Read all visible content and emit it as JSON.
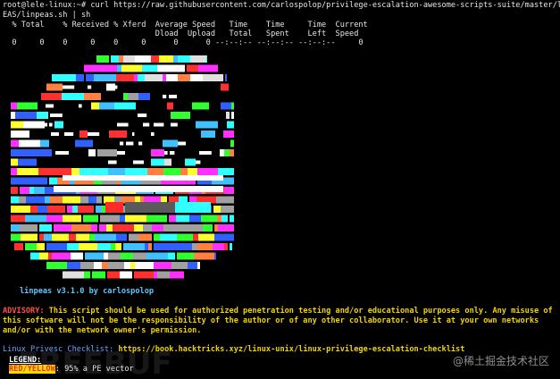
{
  "terminal": {
    "prompt": "root@lele-linux:~#",
    "command_line1": " curl https://raw.githubusercontent.com/carlospolop/privilege-escalation-awesome-scripts-suite/master/linP",
    "command_line2": "EAS/linpeas.sh | sh",
    "curl_header1": "  % Total    % Received % Xferd  Average Speed   Time    Time     Time  Current",
    "curl_header2": "                                 Dload  Upload   Total   Spent    Left  Speed",
    "curl_progress": "  0     0    0     0    0     0      0      0 --:--:-- --:--:-- --:--:--     0"
  },
  "logo": {
    "caption": "linpeas v3.1.0 by carlospolop"
  },
  "advisory": {
    "label": "ADVISORY:",
    "text": " This script should be used for authorized penetration testing and/or educational purposes only. Any misuse of this software will not be the responsibility of the author or of any other collaborator. Use it at your own networks and/or with the network owner's permission."
  },
  "checklist": {
    "label": "Linux Privesc Checklist:",
    "url": " https://book.hacktricks.xyz/linux-unix/linux-privilege-escalation-checklist"
  },
  "legend": {
    "title": "LEGEND:",
    "tag": "RED/YELLOW",
    "desc": ": 95% a PE vector"
  },
  "watermark": {
    "text": "@稀土掘金技术社区"
  },
  "colors": {
    "background": "#000000",
    "caption": "#5ec8ff",
    "advisory_label": "#ff5050",
    "advisory_text": "#f1d400",
    "checklist_label": "#6aa3ff"
  }
}
